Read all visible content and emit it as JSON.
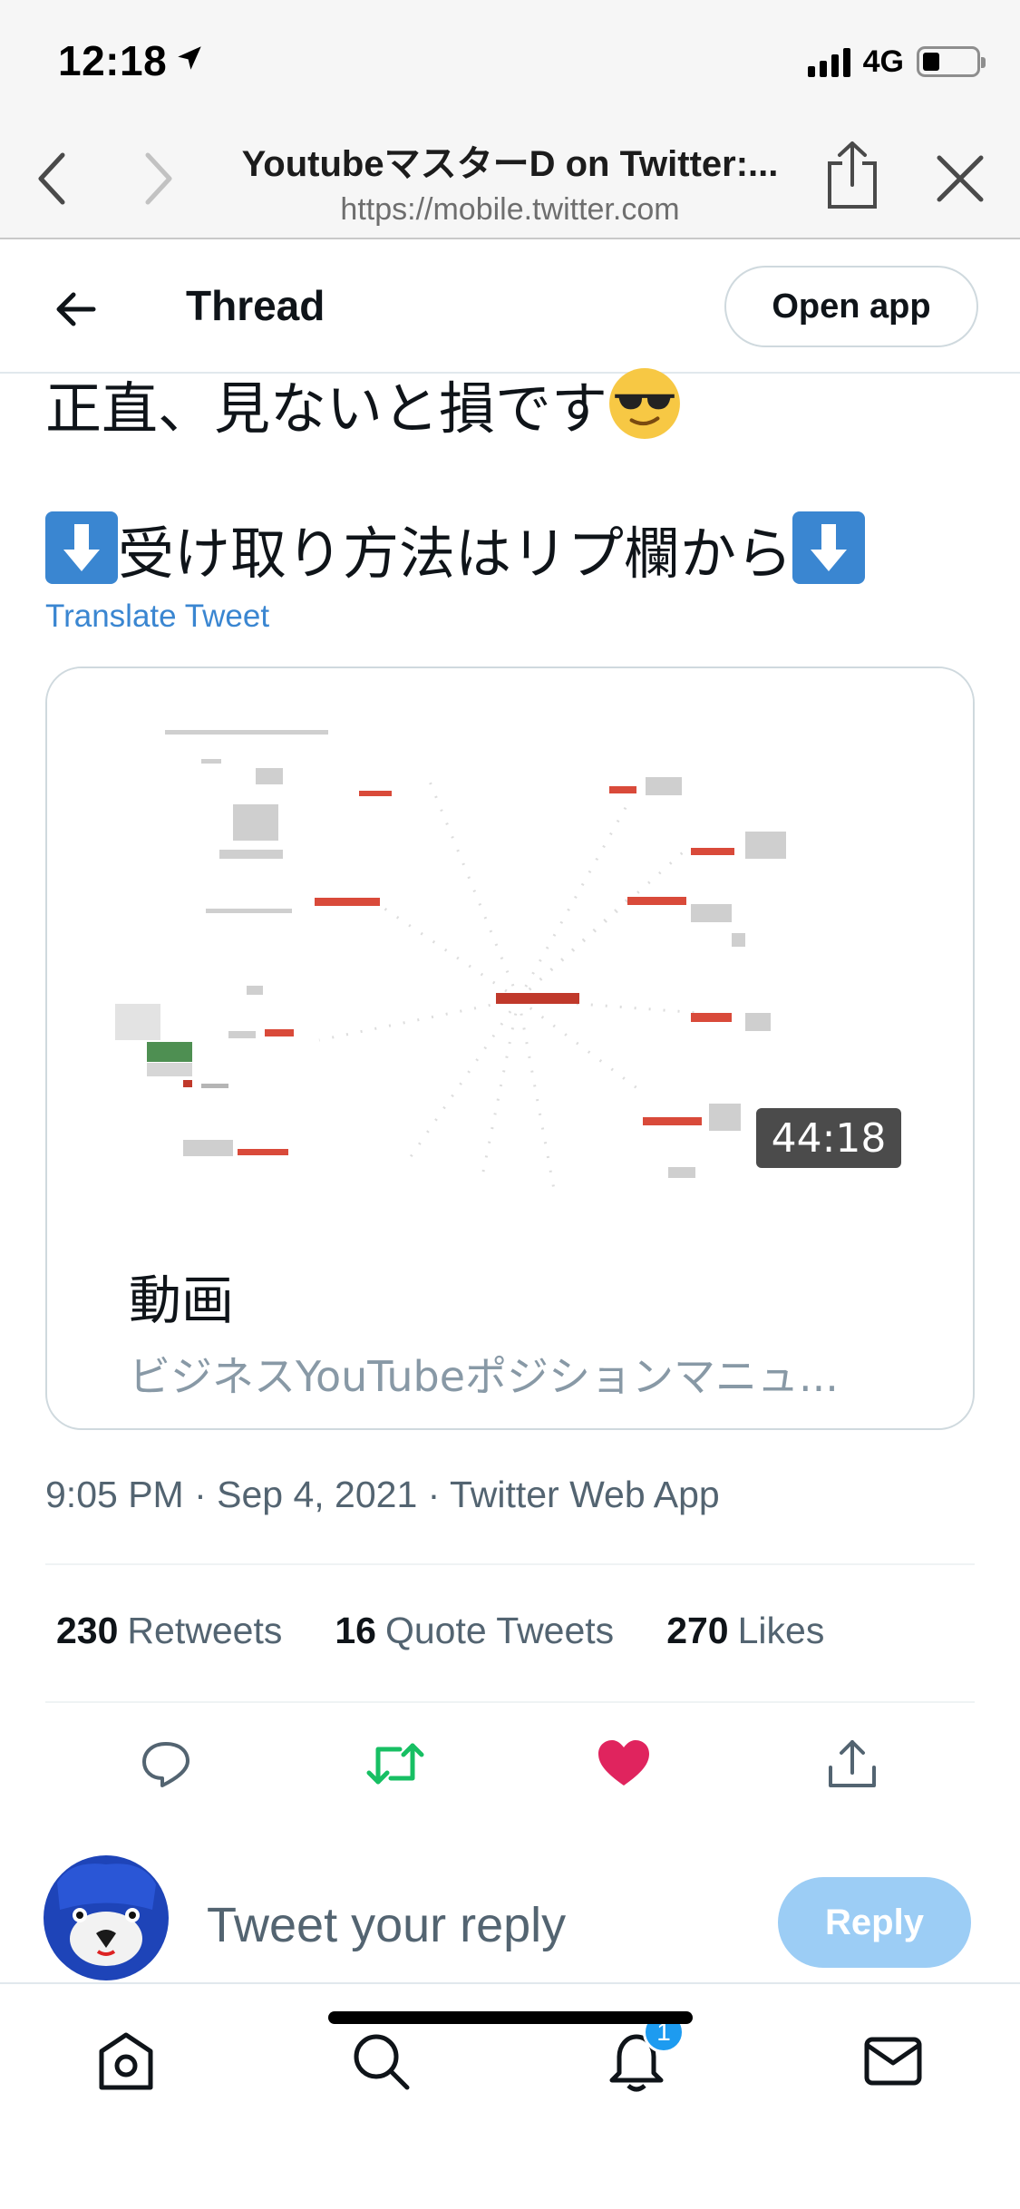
{
  "status_bar": {
    "time": "12:18",
    "network": "4G",
    "icons": [
      "location-arrow-icon",
      "signal-icon",
      "battery-icon"
    ]
  },
  "browser": {
    "page_title": "YoutubeマスターD on Twitter:...",
    "url": "https://mobile.twitter.com",
    "icons": [
      "chevron-left-icon",
      "chevron-right-icon",
      "share-icon",
      "close-icon"
    ]
  },
  "header": {
    "title": "Thread",
    "open_app_label": "Open app",
    "icons": [
      "back-arrow-icon"
    ]
  },
  "tweet": {
    "line1_text": "正直、見ないと損です",
    "line2_text": "受け取り方法はリプ欄から",
    "translate_label": "Translate Tweet",
    "icons": [
      "sunglasses-emoji-icon",
      "down-arrow-emoji-icon"
    ]
  },
  "card": {
    "duration": "44:18",
    "title": "動画",
    "subtitle": "ビジネスYouTubeポジションマニュ..."
  },
  "meta": {
    "timestamp": "9:05 PM · Sep 4, 2021 · Twitter Web App"
  },
  "stats": {
    "retweets_count": "230",
    "retweets_label": "Retweets",
    "quotes_count": "16",
    "quotes_label": "Quote Tweets",
    "likes_count": "270",
    "likes_label": "Likes"
  },
  "actions": {
    "icons": [
      "reply-icon",
      "retweet-icon",
      "like-icon",
      "share-icon"
    ],
    "retweet_color": "#17bf63",
    "like_color": "#e0245e"
  },
  "reply_bar": {
    "placeholder": "Tweet your reply",
    "button_label": "Reply"
  },
  "bottom_nav": {
    "icons": [
      "home-icon",
      "search-icon",
      "notifications-icon",
      "messages-icon"
    ],
    "notification_count": "1"
  },
  "colors": {
    "accent": "#1d9bf0",
    "link": "#3a86d1",
    "reply_button_disabled": "#9ccdf5"
  }
}
